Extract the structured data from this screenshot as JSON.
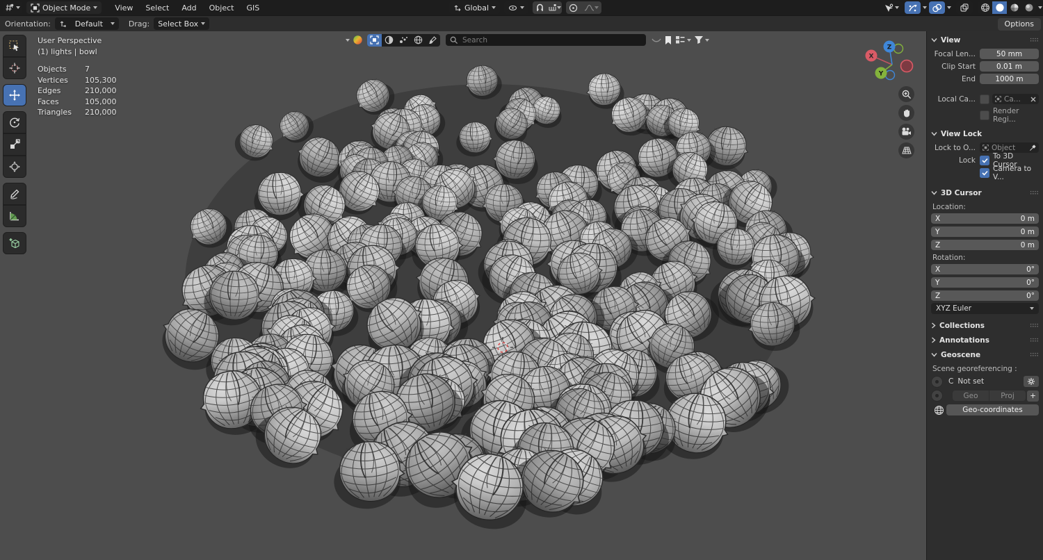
{
  "colors": {
    "accent": "#4772b3",
    "viewport_bg": "#4d4d4d",
    "pea_light": "#d9d9d9",
    "pea_mid": "#a8a8a8",
    "pea_dark": "#6e6e6e",
    "wire": "#3a3a3a",
    "axis_x": "#d95b66",
    "axis_y": "#84b33c",
    "axis_z": "#3f87d9"
  },
  "topbar": {
    "mode": "Object Mode",
    "menus": [
      "View",
      "Select",
      "Add",
      "Object",
      "GIS"
    ],
    "orientation": "Global"
  },
  "tool_settings": {
    "orientation_label": "Orientation:",
    "orientation_value": "Default",
    "drag_label": "Drag:",
    "drag_value": "Select Box",
    "search_placeholder": "Search",
    "options_label": "Options"
  },
  "viewport": {
    "perspective": "User Perspective",
    "scene": "(1) lights | bowl",
    "stats": [
      {
        "label": "Objects",
        "value": "7"
      },
      {
        "label": "Vertices",
        "value": "105,300"
      },
      {
        "label": "Edges",
        "value": "210,000"
      },
      {
        "label": "Faces",
        "value": "105,000"
      },
      {
        "label": "Triangles",
        "value": "210,000"
      }
    ],
    "gizmo": {
      "x": "X",
      "y": "Y",
      "z": "Z"
    }
  },
  "panel": {
    "view": {
      "title": "View",
      "focal_label": "Focal Len...",
      "focal_value": "50 mm",
      "clip_start_label": "Clip Start",
      "clip_start_value": "0.01 m",
      "clip_end_label": "End",
      "clip_end_value": "1000 m",
      "local_cam_label": "Local Ca...",
      "local_cam_value": "Ca...",
      "render_region_label": "Render Regi..."
    },
    "view_lock": {
      "title": "View Lock",
      "lock_to_label": "Lock to O...",
      "lock_to_placeholder": "Object",
      "lock_label": "Lock",
      "to_3d_cursor": "To 3D Cursor",
      "camera_to_view": "Camera to V..."
    },
    "cursor3d": {
      "title": "3D Cursor",
      "location_label": "Location:",
      "rotation_label": "Rotation:",
      "location_rows": [
        {
          "axis": "X",
          "value": "0 m"
        },
        {
          "axis": "Y",
          "value": "0 m"
        },
        {
          "axis": "Z",
          "value": "0 m"
        }
      ],
      "rotation_rows": [
        {
          "axis": "X",
          "value": "0°"
        },
        {
          "axis": "Y",
          "value": "0°"
        },
        {
          "axis": "Z",
          "value": "0°"
        }
      ],
      "rotation_mode": "XYZ Euler"
    },
    "collections_title": "Collections",
    "annotations_title": "Annotations",
    "geoscene": {
      "title": "Geoscene",
      "georef_label": "Scene georeferencing :",
      "crs_letter": "C",
      "crs_value": "Not set",
      "geo_label": "Geo",
      "proj_label": "Proj",
      "plus_label": "+",
      "geo_coords_label": "Geo-coordinates"
    }
  }
}
